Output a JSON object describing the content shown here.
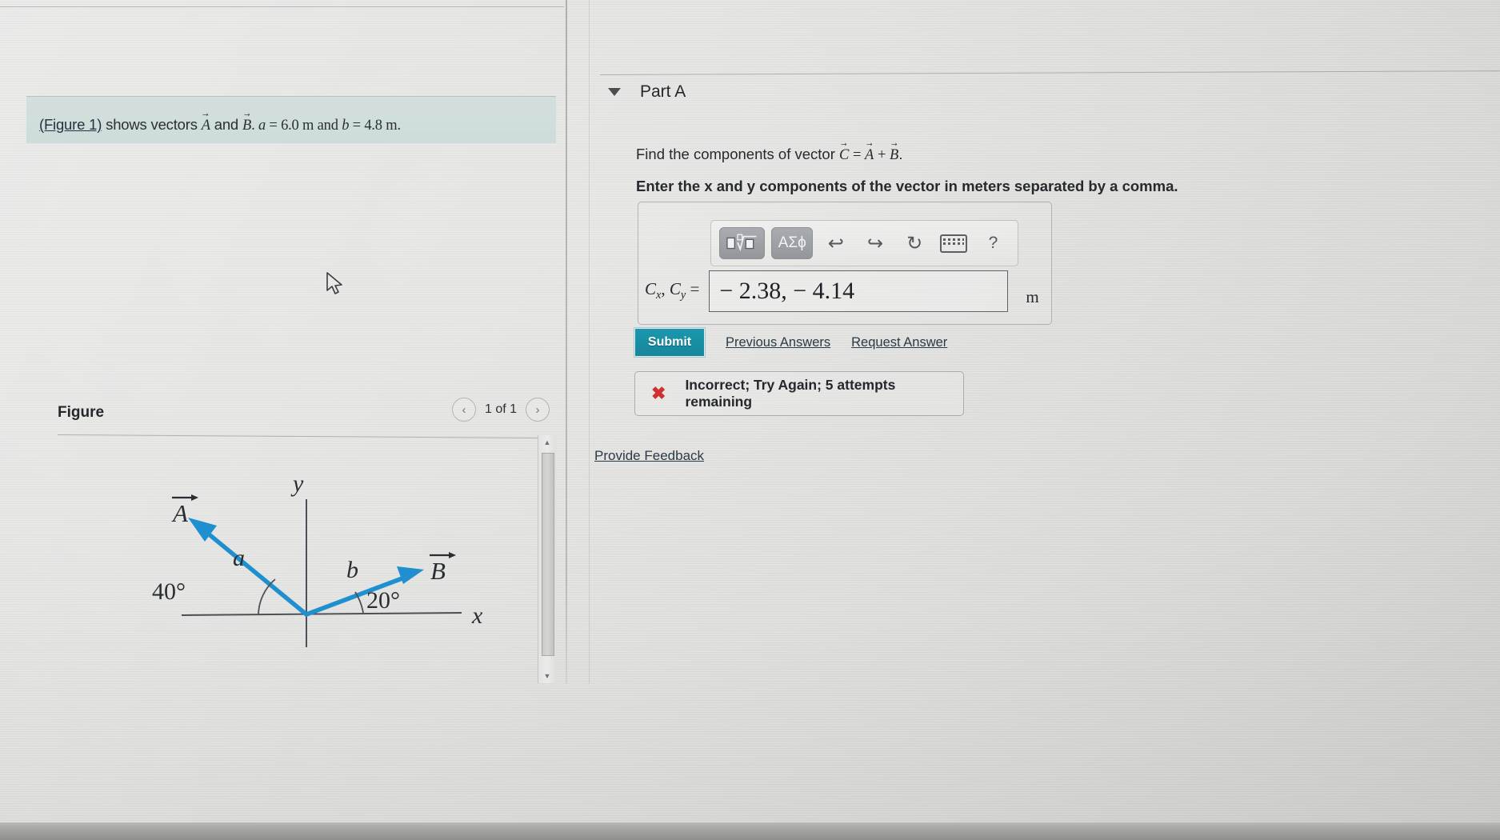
{
  "problem": {
    "figure_link": "(Figure 1)",
    "text_before": " shows vectors ",
    "vec_a": "A",
    "text_and": " and ",
    "vec_b": "B",
    "givens": ". a = 6.0 m and b = 4.8 m."
  },
  "figure_panel": {
    "title": "Figure",
    "pager_prev": "‹",
    "pager_label": "1 of 1",
    "pager_next": "›",
    "scroll_up": "▲",
    "scroll_down": "▼"
  },
  "part": {
    "caret": "",
    "title": "Part A",
    "question": "Find the components of vector C = A + B.",
    "instruction": "Enter the x and y components of the vector in meters separated by a comma."
  },
  "mathbar": {
    "template_button": "√",
    "greek_button": "ΑΣϕ",
    "undo": "↩",
    "redo": "↪",
    "reset": "↻",
    "keyboard": "keyboard",
    "help": "?"
  },
  "answer": {
    "label_cx": "C",
    "label_cx_sub": "x",
    "label_sep": ", ",
    "label_cy": "C",
    "label_cy_sub": "y",
    "label_eq": " =",
    "value": "− 2.38, − 4.14",
    "placeholder": "",
    "unit": "m"
  },
  "actions": {
    "submit": "Submit",
    "previous_answers": "Previous Answers",
    "request_answer": "Request Answer"
  },
  "feedback": {
    "icon": "✖",
    "message": "Incorrect; Try Again; 5 attempts remaining",
    "provide_feedback": "Provide Feedback"
  },
  "colors": {
    "accent_teal": "#1b97ad",
    "error_red": "#cf3030",
    "vector_blue": "#1f8fd0",
    "banner": "#d0dddb"
  },
  "chart_data": {
    "type": "diagram",
    "title": "Vectors A and B in the xy-plane",
    "axes": {
      "x_label": "x",
      "y_label": "y"
    },
    "vectors": [
      {
        "name": "A",
        "label": "A",
        "magnitude_label": "a",
        "magnitude": "6.0 m",
        "angle_deg": 140,
        "angle_label": "40°",
        "angle_from": "negative x-axis",
        "color": "#1f8fd0"
      },
      {
        "name": "B",
        "label": "B",
        "magnitude_label": "b",
        "magnitude": "4.8 m",
        "angle_deg": 20,
        "angle_label": "20°",
        "angle_from": "positive x-axis",
        "color": "#1f8fd0"
      }
    ],
    "annotations": [
      "40°",
      "20°",
      "a",
      "b",
      "x",
      "y"
    ]
  }
}
